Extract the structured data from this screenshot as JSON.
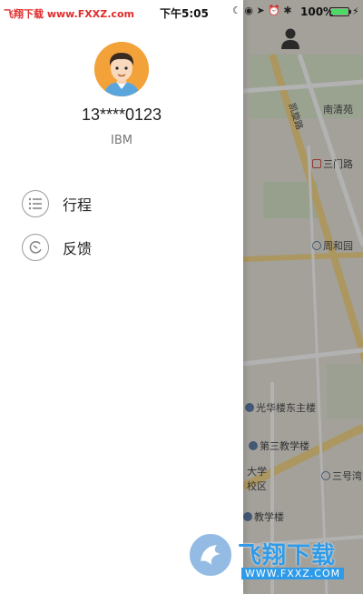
{
  "status_bar": {
    "watermark": "飞翔下载 www.FXXZ.com",
    "time": "下午5:05",
    "battery_percent": "100%"
  },
  "profile": {
    "phone": "13****0123",
    "company": "IBM"
  },
  "menu": [
    {
      "label": "行程",
      "icon": "list-icon"
    },
    {
      "label": "反馈",
      "icon": "feedback-icon"
    }
  ],
  "map": {
    "labels": [
      "南清苑",
      "三门路",
      "周和园",
      "光华楼东主楼",
      "第三教学楼",
      "大学校区",
      "三号湾",
      "教学楼"
    ],
    "road_label": "凯旋路"
  },
  "watermark": {
    "brand": "飞翔下载",
    "url": "WWW.FXXZ.COM"
  },
  "colors": {
    "accent_watermark": "#2f9be8",
    "avatar_bg": "#f3a23a",
    "battery": "#4cd964"
  }
}
